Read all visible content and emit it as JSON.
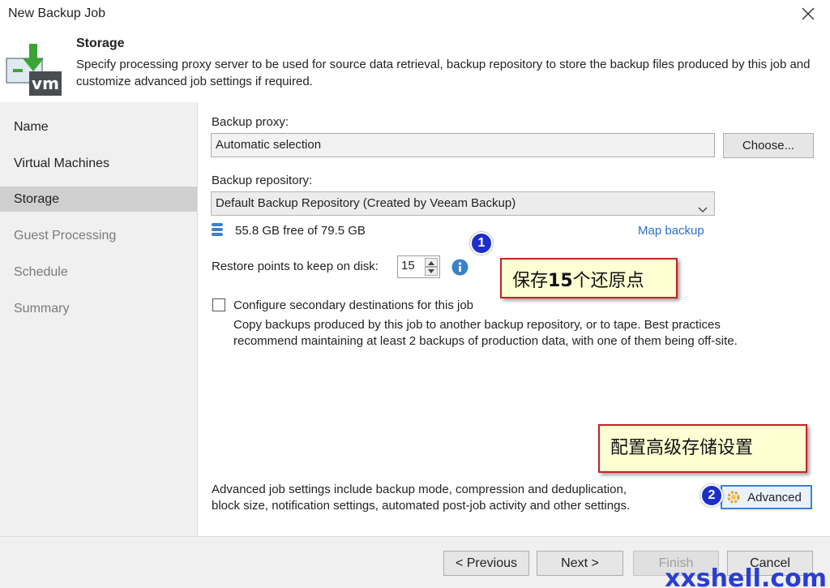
{
  "window": {
    "title": "New Backup Job"
  },
  "header": {
    "title": "Storage",
    "description": "Specify processing proxy server to be used for source data retrieval, backup repository to store the backup files produced by this job and customize advanced job settings if required.",
    "logo_text": "vm"
  },
  "sidebar": {
    "items": [
      {
        "label": "Name"
      },
      {
        "label": "Virtual Machines"
      },
      {
        "label": "Storage"
      },
      {
        "label": "Guest Processing"
      },
      {
        "label": "Schedule"
      },
      {
        "label": "Summary"
      }
    ]
  },
  "form": {
    "proxy_label": "Backup proxy:",
    "proxy_value": "Automatic selection",
    "choose_button": "Choose...",
    "repo_label": "Backup repository:",
    "repo_value": "Default Backup Repository (Created by Veeam Backup)",
    "free_space": "55.8 GB free of 79.5 GB",
    "map_backup_link": "Map backup",
    "restore_points_label": "Restore points to keep on disk:",
    "restore_points_value": "15",
    "secondary_label": "Configure secondary destinations for this job",
    "secondary_checked": false,
    "secondary_desc_1": "Copy backups produced by this job to another backup repository, or to tape. Best practices",
    "secondary_desc_2": "recommend maintaining at least 2 backups of production data, with one of them being off-site.",
    "advanced_desc_1": "Advanced job settings include backup mode, compression and deduplication,",
    "advanced_desc_2": "block size, notification settings, automated post-job activity and other settings.",
    "advanced_button": "Advanced"
  },
  "annotations": {
    "callout_1_pre": "保存",
    "callout_1_num": "15",
    "callout_1_post": "个还原点",
    "callout_2": "配置高级存储设置",
    "marker_1": "1",
    "marker_2": "2"
  },
  "footer": {
    "previous": "< Previous",
    "next": "Next >",
    "finish": "Finish",
    "cancel": "Cancel"
  },
  "watermark": "xxshell.com",
  "colors": {
    "accent_link": "#2a6fcf",
    "callout_border": "#c82020",
    "callout_bg": "#ffffd4",
    "marker": "#1c2fc9",
    "selected_item": "#cfcfcf"
  }
}
